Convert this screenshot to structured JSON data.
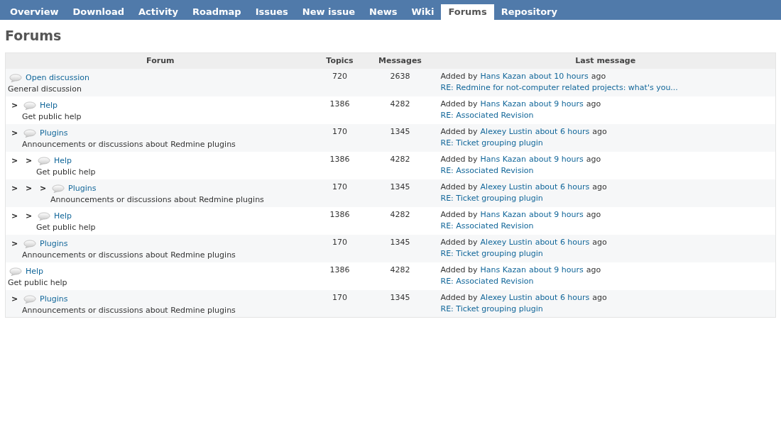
{
  "tabs": [
    {
      "label": "Overview",
      "selected": false
    },
    {
      "label": "Download",
      "selected": false
    },
    {
      "label": "Activity",
      "selected": false
    },
    {
      "label": "Roadmap",
      "selected": false
    },
    {
      "label": "Issues",
      "selected": false
    },
    {
      "label": "New issue",
      "selected": false
    },
    {
      "label": "News",
      "selected": false
    },
    {
      "label": "Wiki",
      "selected": false
    },
    {
      "label": "Forums",
      "selected": true
    },
    {
      "label": "Repository",
      "selected": false
    }
  ],
  "title": "Forums",
  "table": {
    "columns": [
      "Forum",
      "Topics",
      "Messages",
      "Last message"
    ],
    "rows": [
      {
        "markers": [],
        "name": "Open discussion",
        "description": "General discussion",
        "topics": "720",
        "messages": "2638",
        "added_by": "Added by",
        "author": "Hans Kazan",
        "time": "about 10 hours",
        "ago": "ago",
        "subject": "RE: Redmine for not-computer related projects: what's you..."
      },
      {
        "markers": [
          ">"
        ],
        "name": "Help",
        "description": "Get public help",
        "topics": "1386",
        "messages": "4282",
        "added_by": "Added by",
        "author": "Hans Kazan",
        "time": "about 9 hours",
        "ago": "ago",
        "subject": "RE: Associated Revision"
      },
      {
        "markers": [
          ">"
        ],
        "name": "Plugins",
        "description": "Announcements or discussions about Redmine plugins",
        "topics": "170",
        "messages": "1345",
        "added_by": "Added by",
        "author": "Alexey Lustin",
        "time": "about 6 hours",
        "ago": "ago",
        "subject": "RE: Ticket grouping plugin"
      },
      {
        "markers": [
          ">",
          ">"
        ],
        "name": "Help",
        "description": "Get public help",
        "topics": "1386",
        "messages": "4282",
        "added_by": "Added by",
        "author": "Hans Kazan",
        "time": "about 9 hours",
        "ago": "ago",
        "subject": "RE: Associated Revision"
      },
      {
        "markers": [
          ">",
          ">",
          ">"
        ],
        "name": "Plugins",
        "description": "Announcements or discussions about Redmine plugins",
        "topics": "170",
        "messages": "1345",
        "added_by": "Added by",
        "author": "Alexey Lustin",
        "time": "about 6 hours",
        "ago": "ago",
        "subject": "RE: Ticket grouping plugin"
      },
      {
        "markers": [
          ">",
          ">"
        ],
        "name": "Help",
        "description": "Get public help",
        "topics": "1386",
        "messages": "4282",
        "added_by": "Added by",
        "author": "Hans Kazan",
        "time": "about 9 hours",
        "ago": "ago",
        "subject": "RE: Associated Revision"
      },
      {
        "markers": [
          ">"
        ],
        "name": "Plugins",
        "description": "Announcements or discussions about Redmine plugins",
        "topics": "170",
        "messages": "1345",
        "added_by": "Added by",
        "author": "Alexey Lustin",
        "time": "about 6 hours",
        "ago": "ago",
        "subject": "RE: Ticket grouping plugin"
      },
      {
        "markers": [],
        "name": "Help",
        "description": "Get public help",
        "topics": "1386",
        "messages": "4282",
        "added_by": "Added by",
        "author": "Hans Kazan",
        "time": "about 9 hours",
        "ago": "ago",
        "subject": "RE: Associated Revision"
      },
      {
        "markers": [
          ">"
        ],
        "name": "Plugins",
        "description": "Announcements or discussions about Redmine plugins",
        "topics": "170",
        "messages": "1345",
        "added_by": "Added by",
        "author": "Alexey Lustin",
        "time": "about 6 hours",
        "ago": "ago",
        "subject": "RE: Ticket grouping plugin"
      }
    ]
  }
}
